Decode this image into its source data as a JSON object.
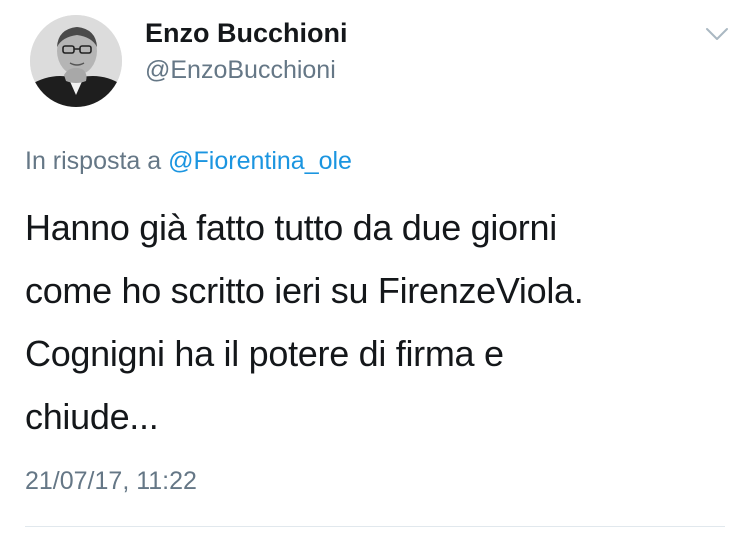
{
  "author": {
    "display_name": "Enzo Bucchioni",
    "handle": "@EnzoBucchioni",
    "avatar_icon": "profile-photo"
  },
  "reply": {
    "prefix": "In risposta a ",
    "mention": "@Fiorentina_ole"
  },
  "tweet": {
    "lines": [
      "Hanno già fatto tutto da due giorni",
      "come ho scritto ieri su FirenzeViola.",
      "Cognigni ha il potere di firma e",
      "chiude..."
    ]
  },
  "timestamp": "21/07/17, 11:22",
  "menu_icon": "chevron-down-icon",
  "colors": {
    "text": "#14171a",
    "secondary": "#657786",
    "link": "#1b95e0",
    "divider": "#e1e8ed"
  }
}
